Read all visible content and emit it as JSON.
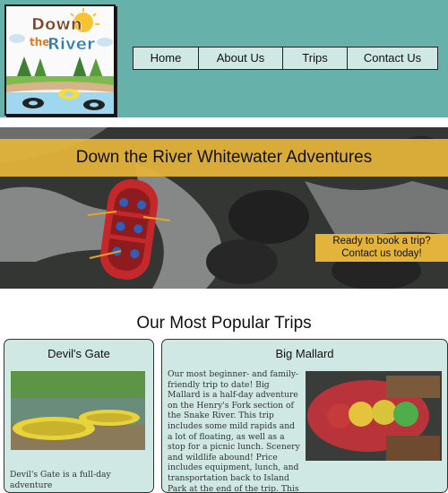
{
  "logo": {
    "word1": "Down",
    "word2": "the",
    "word3": "River"
  },
  "nav": {
    "items": [
      "Home",
      "About Us",
      "Trips",
      "Contact Us"
    ]
  },
  "hero": {
    "title": "Down the River Whitewater Adventures",
    "cta_line1": "Ready to book a trip?",
    "cta_line2": "Contact us today!"
  },
  "popular": {
    "heading": "Our Most Popular Trips",
    "trips": [
      {
        "title": "Devil's Gate",
        "text": "Devil's Gate is a full-day adventure"
      },
      {
        "title": "Big Mallard",
        "text": "Our most beginner- and family-friendly trip to date! Big Mallard is a half-day adventure on the Henry's Fork section of the Snake River. This trip includes some mild rapids and a lot of floating, as well as a stop for a picnic lunch. Scenery and wildlife abound! Price includes equipment, lunch, and transportation back to Island Park at the end of the trip. This is our"
      }
    ]
  },
  "colors": {
    "header": "#66b2aa",
    "banner": "#e3b33b",
    "card": "#cfe8e3"
  }
}
